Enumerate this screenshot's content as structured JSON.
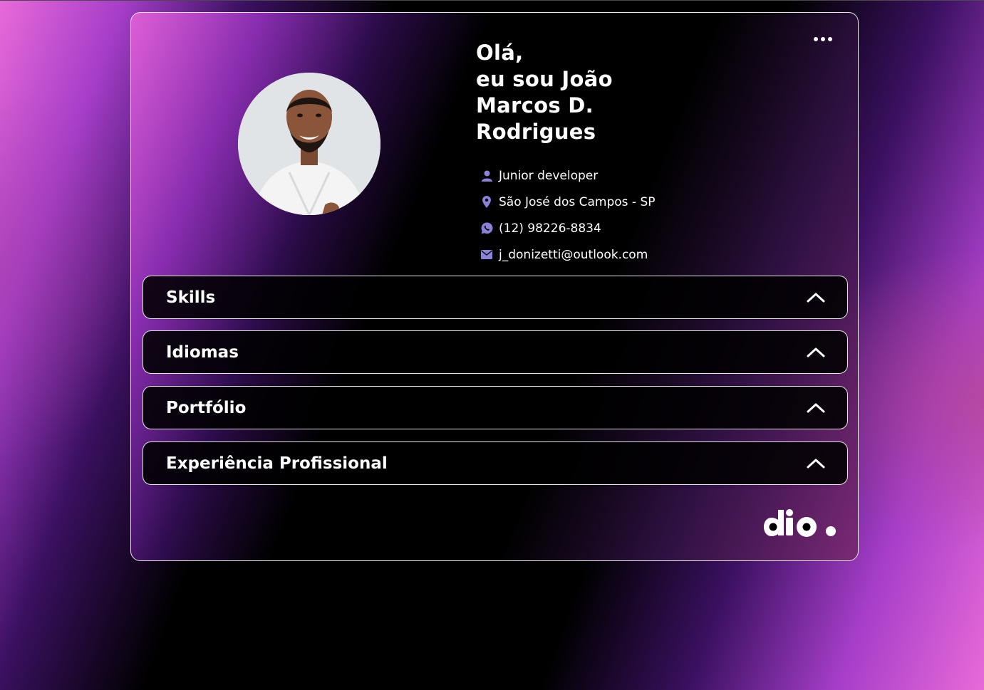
{
  "profile": {
    "greeting_line1": "Olá,",
    "greeting_line2": "eu sou João",
    "greeting_line3": "Marcos D.",
    "greeting_line4": "Rodrigues",
    "role": "Junior developer",
    "location": "São José dos Campos - SP",
    "phone": "(12) 98226-8834",
    "email": "j_donizetti@outlook.com"
  },
  "icons": {
    "role": "user-icon",
    "location": "map-pin-icon",
    "phone": "whatsapp-icon",
    "email": "envelope-icon",
    "menu": "more-horizontal-icon",
    "accordion": "chevron-up-icon"
  },
  "sections": [
    {
      "label": "Skills"
    },
    {
      "label": "Idiomas"
    },
    {
      "label": "Portfólio"
    },
    {
      "label": "Experiência Profissional"
    }
  ],
  "colors": {
    "accent": "#e86ad8",
    "icon": "#8a82d8",
    "border": "#e6e6e6",
    "background": "#000000"
  }
}
